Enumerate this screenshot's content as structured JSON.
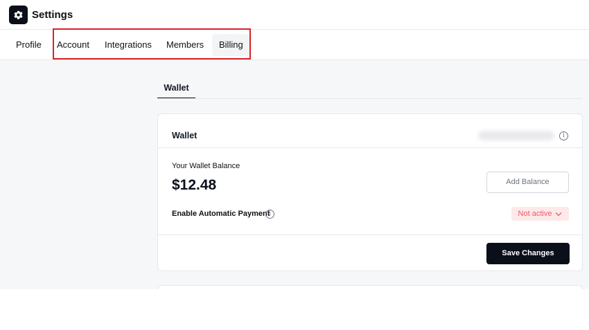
{
  "header": {
    "icon": "gear-icon",
    "title": "Settings"
  },
  "tabs": [
    {
      "label": "Profile",
      "active": false
    },
    {
      "label": "Account",
      "active": false
    },
    {
      "label": "Integrations",
      "active": false
    },
    {
      "label": "Members",
      "active": false
    },
    {
      "label": "Billing",
      "active": true
    }
  ],
  "subtab": {
    "label": "Wallet"
  },
  "wallet_card": {
    "title": "Wallet",
    "balance_label": "Your Wallet Balance",
    "balance": "$12.48",
    "add_balance_label": "Add Balance",
    "auto_payment_label": "Enable Automatic Payment",
    "status_value": "Not active",
    "save_label": "Save Changes"
  },
  "colors": {
    "highlight": "#d92027",
    "primary_button": "#0b0f1a",
    "status_bg": "#fde8ea",
    "status_text": "#ef5a63"
  }
}
